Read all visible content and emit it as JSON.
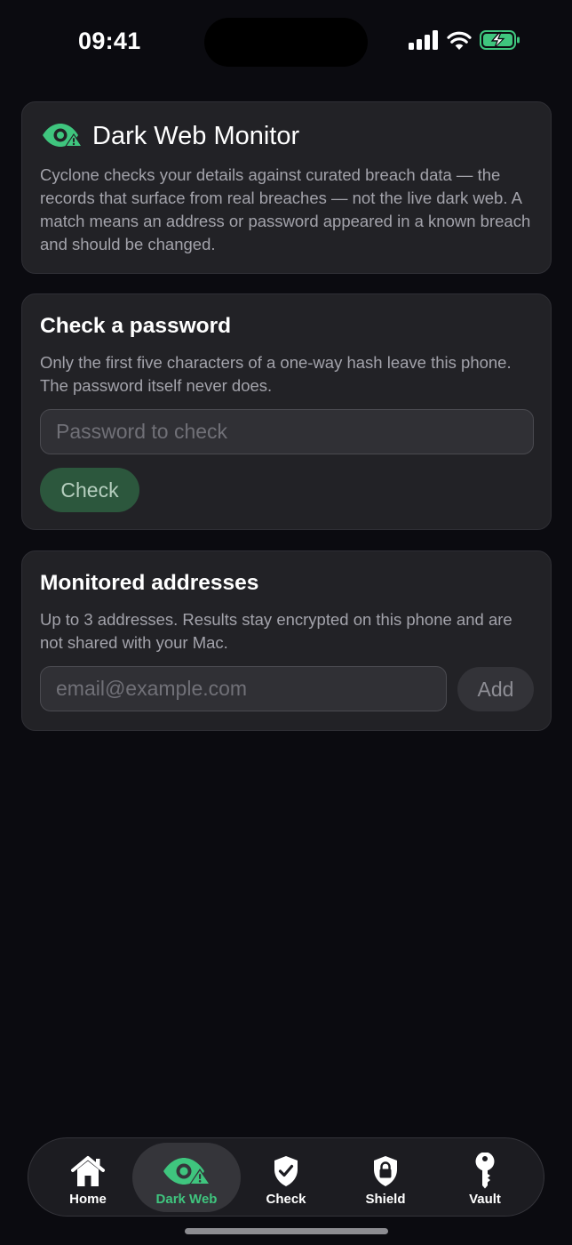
{
  "status_bar": {
    "time": "09:41"
  },
  "colors": {
    "accent": "#3fc57e",
    "background": "#0b0b10",
    "card": "#222226",
    "check_button": "#2c573d"
  },
  "hero": {
    "icon": "eye-warning-icon",
    "title": "Dark Web Monitor",
    "description": "Cyclone checks your details against curated breach data — the records that surface from real breaches — not the live dark web. A match means an address or password appeared in a known breach and should be changed."
  },
  "password_check": {
    "title": "Check a password",
    "description": "Only the first five characters of a one-way hash leave this phone. The password itself never does.",
    "input_placeholder": "Password to check",
    "input_value": "",
    "button_label": "Check"
  },
  "monitored": {
    "title": "Monitored addresses",
    "description": "Up to 3 addresses. Results stay encrypted on this phone and are not shared with your Mac.",
    "input_placeholder": "email@example.com",
    "input_value": "",
    "button_label": "Add"
  },
  "tabbar": {
    "active": "Dark Web",
    "tabs": [
      {
        "label": "Home",
        "icon": "home-icon"
      },
      {
        "label": "Dark Web",
        "icon": "eye-warning-icon"
      },
      {
        "label": "Check",
        "icon": "shield-check-icon"
      },
      {
        "label": "Shield",
        "icon": "shield-lock-icon"
      },
      {
        "label": "Vault",
        "icon": "key-icon"
      }
    ]
  }
}
